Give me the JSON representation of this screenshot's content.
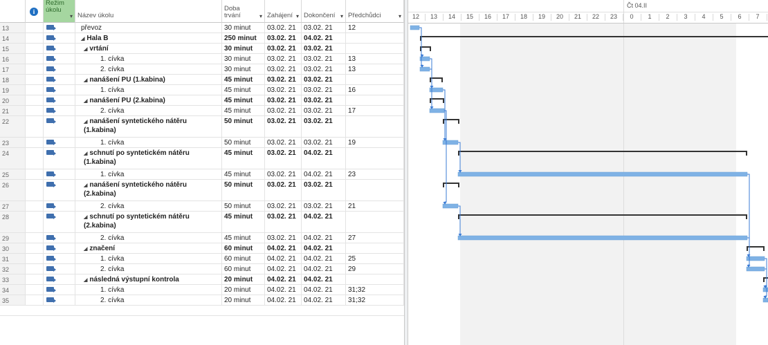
{
  "headers": {
    "info_icon": "i",
    "mode": "Režim úkolu",
    "name": "Název úkolu",
    "duration": "Doba trvání",
    "start": "Zahájení",
    "finish": "Dokončení",
    "predecessors": "Předchůdci",
    "dropdown_icon": "▾"
  },
  "timescale": {
    "day_label": "Čt 04.II",
    "hours": [
      "12",
      "13",
      "14",
      "15",
      "16",
      "17",
      "18",
      "19",
      "20",
      "21",
      "22",
      "23",
      "0",
      "1",
      "2",
      "3",
      "4",
      "5",
      "6",
      "7"
    ]
  },
  "colors": {
    "task_bar": "#7fb2e5",
    "summary_bar": "#333333",
    "link": "#3a7bd5",
    "mode_header": "#a5d6a0"
  },
  "rows": [
    {
      "id": "13",
      "name": "převoz",
      "duration": "30 minut",
      "start": "03.02. 21",
      "finish": "03.02. 21",
      "pred": "12",
      "summary": false,
      "indent": 0
    },
    {
      "id": "14",
      "name": "Hala B",
      "duration": "250 minut",
      "start": "03.02. 21",
      "finish": "04.02. 21",
      "pred": "",
      "summary": true,
      "indent": 0
    },
    {
      "id": "15",
      "name": "vrtání",
      "duration": "30 minut",
      "start": "03.02. 21",
      "finish": "03.02. 21",
      "pred": "",
      "summary": true,
      "indent": 1
    },
    {
      "id": "16",
      "name": "1. cívka",
      "duration": "30 minut",
      "start": "03.02. 21",
      "finish": "03.02. 21",
      "pred": "13",
      "summary": false,
      "indent": 2
    },
    {
      "id": "17",
      "name": "2. cívka",
      "duration": "30 minut",
      "start": "03.02. 21",
      "finish": "03.02. 21",
      "pred": "13",
      "summary": false,
      "indent": 2
    },
    {
      "id": "18",
      "name": "nanášení PU (1.kabina)",
      "duration": "45 minut",
      "start": "03.02. 21",
      "finish": "03.02. 21",
      "pred": "",
      "summary": true,
      "indent": 1
    },
    {
      "id": "19",
      "name": "1. cívka",
      "duration": "45 minut",
      "start": "03.02. 21",
      "finish": "03.02. 21",
      "pred": "16",
      "summary": false,
      "indent": 2
    },
    {
      "id": "20",
      "name": "nanášení PU (2.kabina)",
      "duration": "45 minut",
      "start": "03.02. 21",
      "finish": "03.02. 21",
      "pred": "",
      "summary": true,
      "indent": 1
    },
    {
      "id": "21",
      "name": "2. cívka",
      "duration": "45 minut",
      "start": "03.02. 21",
      "finish": "03.02. 21",
      "pred": "17",
      "summary": false,
      "indent": 2
    },
    {
      "id": "22",
      "name": "nanášení syntetického nátěru (1.kabina)",
      "duration": "50 minut",
      "start": "03.02. 21",
      "finish": "03.02. 21",
      "pred": "",
      "summary": true,
      "indent": 1
    },
    {
      "id": "23",
      "name": "1. cívka",
      "duration": "50 minut",
      "start": "03.02. 21",
      "finish": "03.02. 21",
      "pred": "19",
      "summary": false,
      "indent": 2
    },
    {
      "id": "24",
      "name": "schnutí po syntetickém nátěru (1.kabina)",
      "duration": "45 minut",
      "start": "03.02. 21",
      "finish": "04.02. 21",
      "pred": "",
      "summary": true,
      "indent": 1
    },
    {
      "id": "25",
      "name": "1. cívka",
      "duration": "45 minut",
      "start": "03.02. 21",
      "finish": "04.02. 21",
      "pred": "23",
      "summary": false,
      "indent": 2
    },
    {
      "id": "26",
      "name": "nanášení syntetického nátěru (2.kabina)",
      "duration": "50 minut",
      "start": "03.02. 21",
      "finish": "03.02. 21",
      "pred": "",
      "summary": true,
      "indent": 1
    },
    {
      "id": "27",
      "name": "2. cívka",
      "duration": "50 minut",
      "start": "03.02. 21",
      "finish": "03.02. 21",
      "pred": "21",
      "summary": false,
      "indent": 2
    },
    {
      "id": "28",
      "name": "schnutí po syntetickém nátěru (2.kabina)",
      "duration": "45 minut",
      "start": "03.02. 21",
      "finish": "04.02. 21",
      "pred": "",
      "summary": true,
      "indent": 1
    },
    {
      "id": "29",
      "name": "2. cívka",
      "duration": "45 minut",
      "start": "03.02. 21",
      "finish": "04.02. 21",
      "pred": "27",
      "summary": false,
      "indent": 2
    },
    {
      "id": "30",
      "name": "značení",
      "duration": "60 minut",
      "start": "04.02. 21",
      "finish": "04.02. 21",
      "pred": "",
      "summary": true,
      "indent": 1
    },
    {
      "id": "31",
      "name": "1. cívka",
      "duration": "60 minut",
      "start": "04.02. 21",
      "finish": "04.02. 21",
      "pred": "25",
      "summary": false,
      "indent": 2
    },
    {
      "id": "32",
      "name": "2. cívka",
      "duration": "60 minut",
      "start": "04.02. 21",
      "finish": "04.02. 21",
      "pred": "29",
      "summary": false,
      "indent": 2
    },
    {
      "id": "33",
      "name": "následná výstupní kontrola",
      "duration": "20 minut",
      "start": "04.02. 21",
      "finish": "04.02. 21",
      "pred": "",
      "summary": true,
      "indent": 1
    },
    {
      "id": "34",
      "name": "1. cívka",
      "duration": "20 minut",
      "start": "04.02. 21",
      "finish": "04.02. 21",
      "pred": "31;32",
      "summary": false,
      "indent": 2
    },
    {
      "id": "35",
      "name": "2. cívka",
      "duration": "20 minut",
      "start": "04.02. 21",
      "finish": "04.02. 21",
      "pred": "31;32",
      "summary": false,
      "indent": 2
    }
  ]
}
